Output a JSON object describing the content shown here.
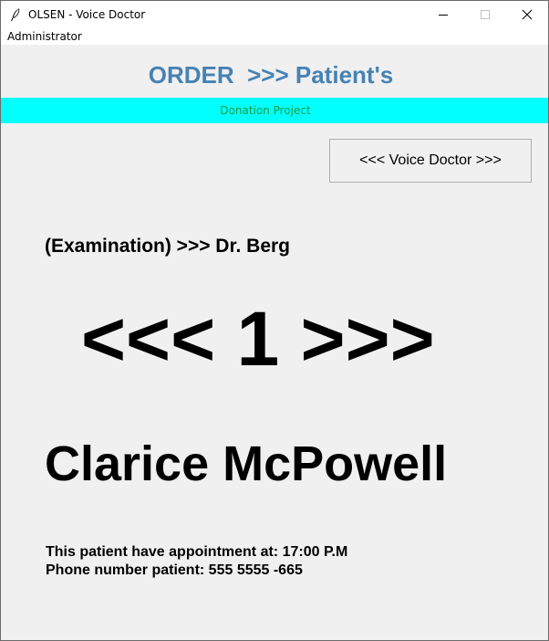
{
  "window": {
    "title": "OLSEN - Voice Doctor",
    "app_icon": "feather-icon",
    "controls": [
      "minimize-icon",
      "maximize-icon",
      "close-icon"
    ]
  },
  "menubar": {
    "items": [
      {
        "label": "Administrator"
      }
    ]
  },
  "header": {
    "title": "ORDER  >>> Patient's",
    "color": "#4682b4"
  },
  "banner": {
    "text": "Donation Project",
    "background": "#00ffff",
    "text_color": "#1a9a3c"
  },
  "toolbar": {
    "voice_doctor_label": "<<< Voice Doctor >>>"
  },
  "main": {
    "examination": "(Examination) >>> Dr. Berg",
    "order_number": "<<< 1 >>>",
    "patient_name": "Clarice McPowell",
    "appointment": "This patient have appointment at: 17:00 P.M",
    "phone": "Phone number patient: 555 5555 -665"
  }
}
